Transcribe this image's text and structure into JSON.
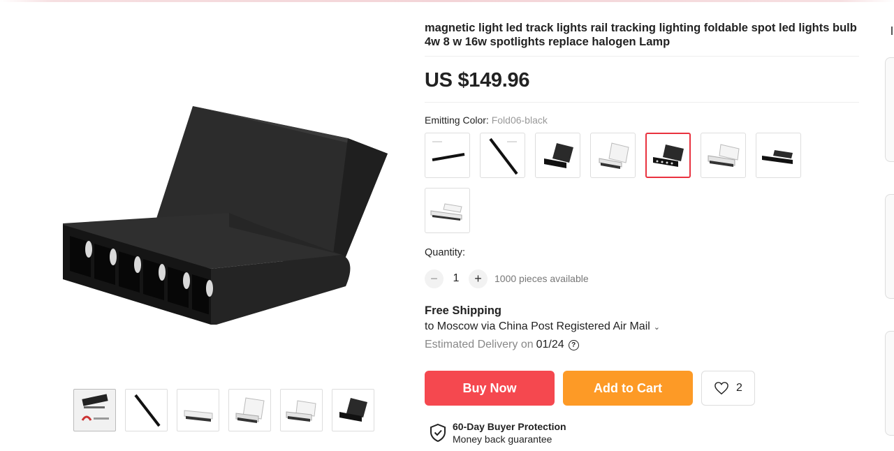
{
  "product": {
    "title": "magnetic light led track lights rail tracking lighting foldable spot led lights bulb 4w 8 w 16w spotlights replace halogen Lamp",
    "price": "US $149.96"
  },
  "variant": {
    "label": "Emitting Color:",
    "selected": "Fold06-black",
    "swatch_count": 8,
    "selected_index": 4
  },
  "quantity": {
    "label": "Quantity:",
    "value": "1",
    "minus": "−",
    "plus": "+",
    "available": "1000 pieces available"
  },
  "shipping": {
    "title": "Free Shipping",
    "route": "to Moscow via China Post Registered Air Mail",
    "estimate_label": "Estimated Delivery on",
    "estimate_date": "01/24",
    "help": "?"
  },
  "actions": {
    "buy_now": "Buy Now",
    "add_to_cart": "Add to Cart",
    "wishlist_count": "2"
  },
  "protection": {
    "title": "60-Day Buyer Protection",
    "subtitle": "Money back guarantee"
  },
  "colors": {
    "buy": "#f5484f",
    "cart": "#fd9a26",
    "selected_border": "#e9323f"
  }
}
